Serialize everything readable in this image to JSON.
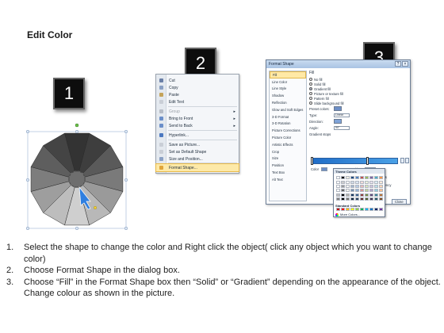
{
  "title": "Edit Color",
  "steps": [
    {
      "number": "1"
    },
    {
      "number": "2"
    },
    {
      "number": "3"
    }
  ],
  "context_menu": {
    "items": [
      {
        "label": "Cut",
        "icon": "scissors-icon",
        "color": "#6a7fa6"
      },
      {
        "label": "Copy",
        "icon": "copy-icon",
        "color": "#8aa0c4"
      },
      {
        "label": "Paste",
        "icon": "paste-icon",
        "color": "#c4a35a"
      },
      {
        "label": "Edit Text",
        "icon": "edit-text-icon",
        "color": "#c9ced6"
      },
      {
        "label": "Group",
        "icon": "group-icon",
        "color": "#b6bcc6",
        "disabled": true,
        "submenu": true
      },
      {
        "label": "Bring to Front",
        "icon": "bring-to-front-icon",
        "color": "#6b8fc9",
        "submenu": true
      },
      {
        "label": "Send to Back",
        "icon": "send-to-back-icon",
        "color": "#6b8fc9",
        "submenu": true
      },
      {
        "label": "Hyperlink...",
        "icon": "hyperlink-icon",
        "color": "#4b78c0"
      },
      {
        "label": "Save as Picture...",
        "icon": "save-picture-icon",
        "color": "#c9ced6"
      },
      {
        "label": "Set as Default Shape",
        "icon": "default-shape-icon",
        "color": "#c9ced6"
      },
      {
        "label": "Size and Position...",
        "icon": "size-position-icon",
        "color": "#8aa0c4"
      },
      {
        "label": "Format Shape...",
        "icon": "format-shape-icon",
        "color": "#e0a53a",
        "highlight": true
      }
    ]
  },
  "dialog": {
    "title": "Format Shape",
    "nav": [
      "Fill",
      "Line Color",
      "Line Style",
      "Shadow",
      "Reflection",
      "Glow and Soft Edges",
      "3-D Format",
      "3-D Rotation",
      "Picture Corrections",
      "Picture Color",
      "Artistic Effects",
      "Crop",
      "Size",
      "Position",
      "Text Box",
      "Alt Text"
    ],
    "section": "Fill",
    "fill_options": [
      "No fill",
      "Solid fill",
      "Gradient fill",
      "Picture or texture fill",
      "Pattern fill",
      "Slide background fill"
    ],
    "preset_label": "Preset colors:",
    "type_label": "Type:",
    "type_value": "Linear",
    "direction_label": "Direction:",
    "angle_label": "Angle:",
    "angle_value": "90°",
    "gradient_stops_label": "Gradient stops",
    "color_label": "Color",
    "position_label": "Position:",
    "position_value": "65%",
    "brightness_label": "Brightness",
    "transparency_label": "Transparency",
    "rotate_label": "Rotate",
    "close_label": "Close"
  },
  "palette": {
    "theme_label": "Theme Colors",
    "standard_label": "Standard Colors",
    "more_label": "More Colors...",
    "theme_top": [
      "#ffffff",
      "#000000",
      "#eeece1",
      "#1f497d",
      "#4f81bd",
      "#c0504d",
      "#9bbb59",
      "#8064a2",
      "#4bacc6",
      "#f79646"
    ],
    "standard": [
      "#c00000",
      "#ff0000",
      "#ffc000",
      "#ffff00",
      "#92d050",
      "#00b050",
      "#00b0f0",
      "#0070c0",
      "#002060",
      "#7030a0"
    ]
  },
  "instructions": [
    {
      "num": "1.",
      "text": "Select the shape to change the color and Right click the object( click any object which you want to change color)"
    },
    {
      "num": "2.",
      "text": "Choose Format Shape in the dialog box."
    },
    {
      "num": "3.",
      "text": "Choose “Fill” in the Format Shape box then “Solid” or “Gradient” depending on the appearance of the object. Change colour as shown in the picture."
    }
  ]
}
